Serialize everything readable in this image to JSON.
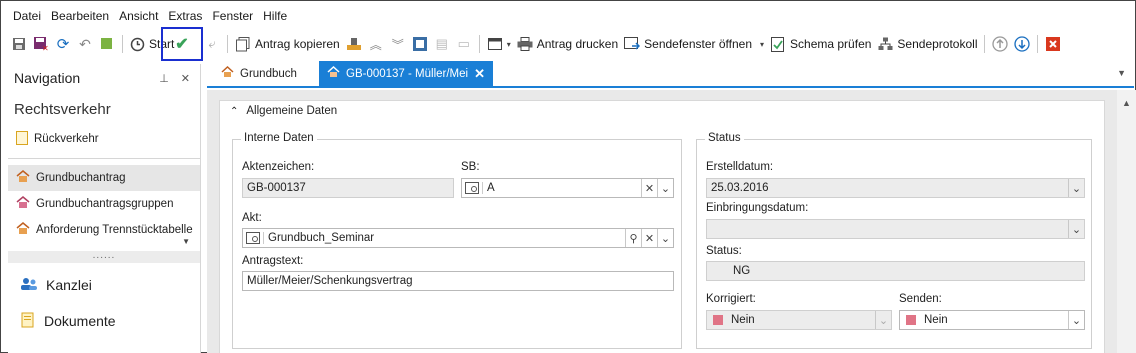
{
  "menu": [
    "Datei",
    "Bearbeiten",
    "Ansicht",
    "Extras",
    "Fenster",
    "Hilfe"
  ],
  "toolbar": {
    "start_label": "Start",
    "antrag_kopieren": "Antrag kopieren",
    "antrag_drucken": "Antrag drucken",
    "sendefenster": "Sendefenster öffnen",
    "schema_pruefen": "Schema prüfen",
    "sendeprotokoll": "Sendeprotokoll"
  },
  "nav": {
    "title": "Navigation",
    "section": "Rechtsverkehr",
    "items": [
      "Rückverkehr",
      "Grundbuchantrag",
      "Grundbuchantragsgruppen",
      "Anforderung Trennstücktabelle"
    ],
    "grip": "......",
    "big_items": [
      "Kanzlei",
      "Dokumente"
    ]
  },
  "tabs": {
    "tab1": "Grundbuch",
    "tab2": "GB-000137 - Müller/Meie"
  },
  "panel": {
    "title": "Allgemeine Daten",
    "interne": {
      "title": "Interne Daten",
      "aktenzeichen_label": "Aktenzeichen:",
      "aktenzeichen": "GB-000137",
      "sb_label": "SB:",
      "sb": "A",
      "akt_label": "Akt:",
      "akt": "Grundbuch_Seminar",
      "antragstext_label": "Antragstext:",
      "antragstext": "Müller/Meier/Schenkungsvertrag"
    },
    "status": {
      "title": "Status",
      "erstelldatum_label": "Erstelldatum:",
      "erstelldatum": "25.03.2016",
      "einbringungsdatum_label": "Einbringungsdatum:",
      "einbringungsdatum": "",
      "status_label": "Status:",
      "status": "NG",
      "korrigiert_label": "Korrigiert:",
      "korrigiert": "Nein",
      "senden_label": "Senden:",
      "senden": "Nein"
    }
  },
  "colors": {
    "accent": "#1a7fd6",
    "focus": "#1a2fd0",
    "swatch": "#e07486"
  }
}
